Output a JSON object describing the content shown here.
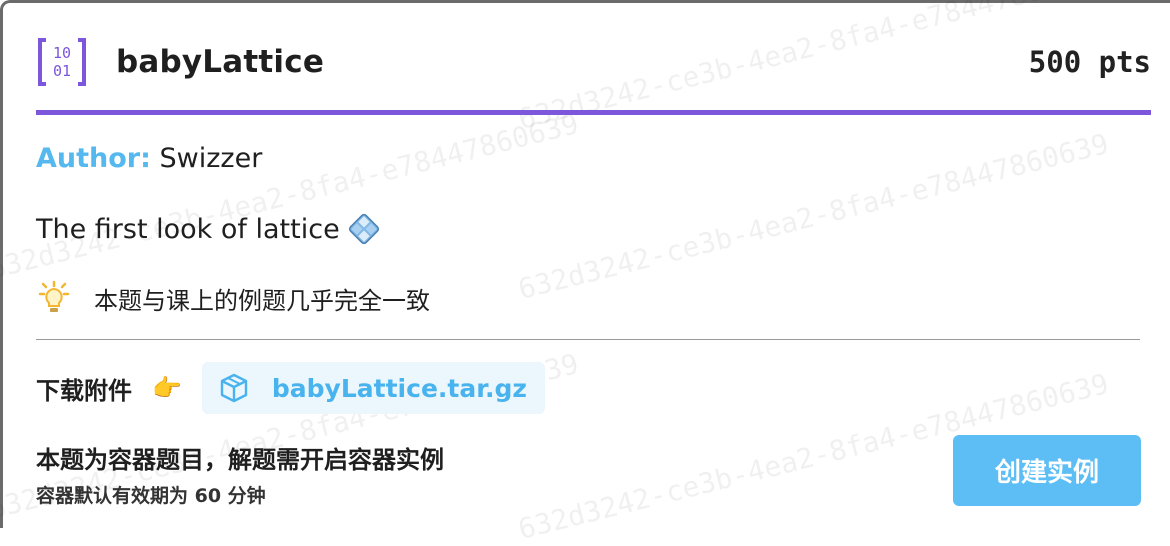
{
  "challenge": {
    "title": "babyLattice",
    "points": "500 pts",
    "author_key": "Author:",
    "author_name": "Swizzer",
    "description": "The first look of lattice",
    "hint": "本题与课上的例题几乎完全一致"
  },
  "attachment": {
    "label": "下载附件",
    "file_name": "babyLattice.tar.gz"
  },
  "container": {
    "title": "本题为容器题目，解题需开启容器实例",
    "subtitle": "容器默认有效期为 60 分钟",
    "start_button": "创建实例"
  },
  "watermark": {
    "text_a": "632d3242-ce3b-4ea2-8fa4-e78447860639",
    "text_b": "632d3242-ce3b-4ea2-8fa4-e78447860639"
  },
  "colors": {
    "accent": "#7c56db",
    "link": "#49b3ee",
    "button": "#5cbef5"
  },
  "icons": {
    "challenge": "binary-bracket-icon",
    "lattice": "lattice-emoji-icon",
    "hint": "lightbulb-icon",
    "pointer": "pointing-hand-icon",
    "file": "package-icon"
  }
}
